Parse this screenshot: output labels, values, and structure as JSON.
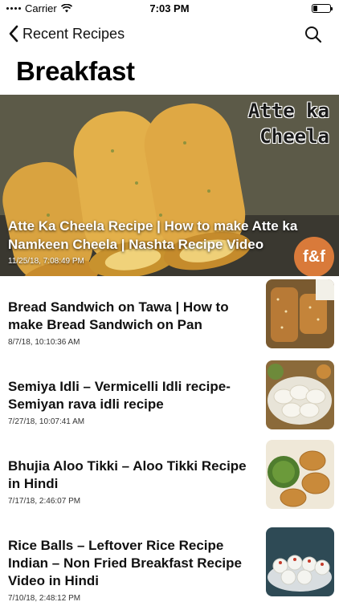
{
  "status_bar": {
    "carrier": "Carrier",
    "time": "7:03 PM",
    "battery_level": 0.25
  },
  "nav": {
    "back_label": "Recent Recipes",
    "back_icon": "chevron-left-icon",
    "search_icon": "search-icon"
  },
  "page": {
    "title": "Breakfast"
  },
  "hero": {
    "overlay_line1": "Atte ka",
    "overlay_line2": "Cheela",
    "title": "Atte Ka Cheela Recipe | How to make Atte ka Namkeen Cheela | Nashta Recipe Video",
    "date": "11/25/18, 7:08:49 PM",
    "logo": "f&f"
  },
  "list": [
    {
      "title": "Bread Sandwich on Tawa | How to make Bread Sandwich on Pan",
      "date": "8/7/18, 10:10:36 AM"
    },
    {
      "title": "Semiya Idli – Vermicelli Idli recipe-Semiyan rava idli recipe",
      "date": "7/27/18, 10:07:41 AM"
    },
    {
      "title": "Bhujia Aloo Tikki – Aloo Tikki Recipe in Hindi",
      "date": "7/17/18, 2:46:07 PM"
    },
    {
      "title": "Rice Balls – Leftover Rice Recipe Indian – Non Fried Breakfast Recipe Video in Hindi",
      "date": "7/10/18, 2:48:12 PM"
    }
  ]
}
